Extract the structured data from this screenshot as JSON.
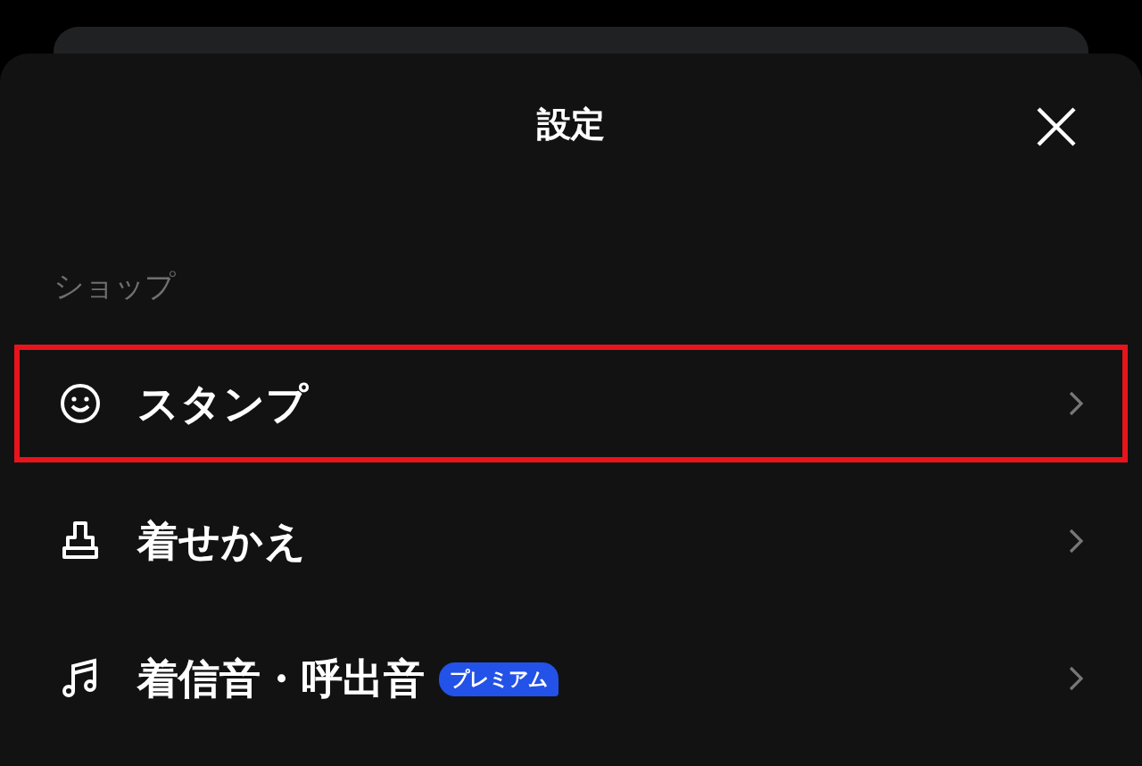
{
  "header": {
    "title": "設定"
  },
  "section": {
    "title": "ショップ"
  },
  "items": [
    {
      "kind": "smiley",
      "label": "スタンプ",
      "highlighted": true
    },
    {
      "kind": "brush",
      "label": "着せかえ",
      "highlighted": false
    },
    {
      "kind": "music",
      "label": "着信音・呼出音",
      "badge": "プレミアム",
      "highlighted": false
    }
  ]
}
